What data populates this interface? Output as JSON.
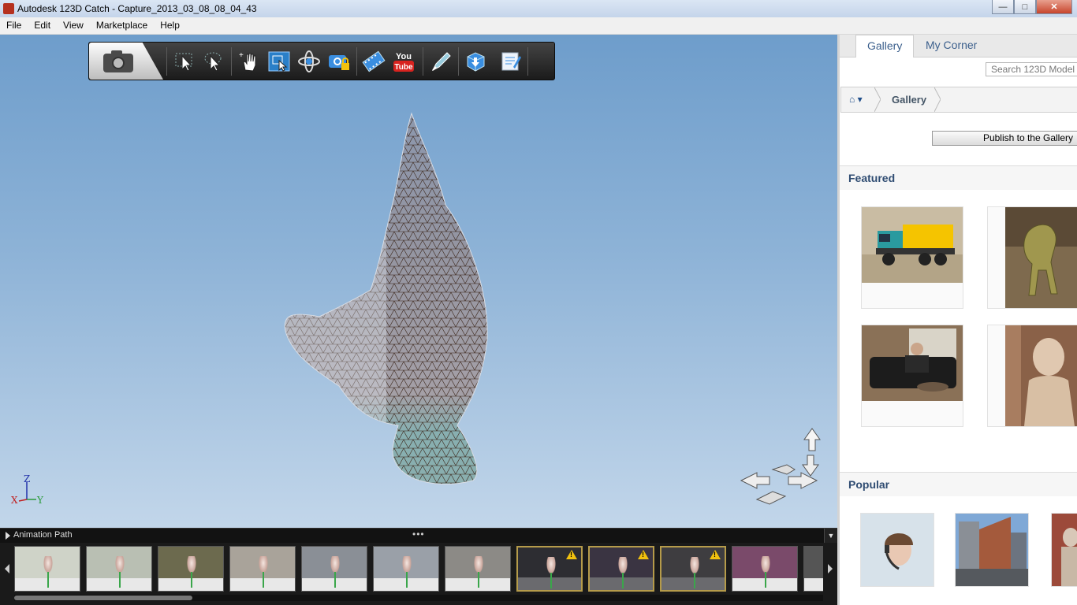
{
  "window": {
    "title": "Autodesk 123D Catch - Capture_2013_03_08_08_04_43",
    "controls": [
      "minimize",
      "maximize",
      "close"
    ]
  },
  "menu": [
    "File",
    "Edit",
    "View",
    "Marketplace",
    "Help"
  ],
  "toolbar": {
    "tools": [
      "camera-icon",
      "select-icon",
      "lasso-select-icon",
      "pan-icon",
      "zoom-window-icon",
      "orbit-icon",
      "camera-lock-icon",
      "film-icon",
      "youtube-icon",
      "pen-tool-icon",
      "export-mesh-icon",
      "notes-icon"
    ],
    "youtube_text": "You",
    "youtube_sub": "Tube"
  },
  "axis": {
    "z": "Z",
    "x": "X",
    "y": "Y"
  },
  "animation": {
    "label": "Animation Path",
    "dots": "•••",
    "frames": [
      {
        "warn": false
      },
      {
        "warn": false
      },
      {
        "warn": false
      },
      {
        "warn": false
      },
      {
        "warn": false
      },
      {
        "warn": false
      },
      {
        "warn": false
      },
      {
        "warn": true
      },
      {
        "warn": true
      },
      {
        "warn": true
      },
      {
        "warn": false
      },
      {
        "warn": false
      }
    ]
  },
  "panel": {
    "tabs": [
      "Gallery",
      "My Corner"
    ],
    "search_placeholder": "Search 123D Model",
    "breadcrumb": "Gallery",
    "publish_label": "Publish to the Gallery",
    "featured_title": "Featured",
    "popular_title": "Popular",
    "featured": [
      "toy dump truck",
      "t-rex figure",
      "man on sofa",
      "classical bust"
    ],
    "popular": [
      "woman with headset",
      "city building",
      "statue"
    ]
  }
}
